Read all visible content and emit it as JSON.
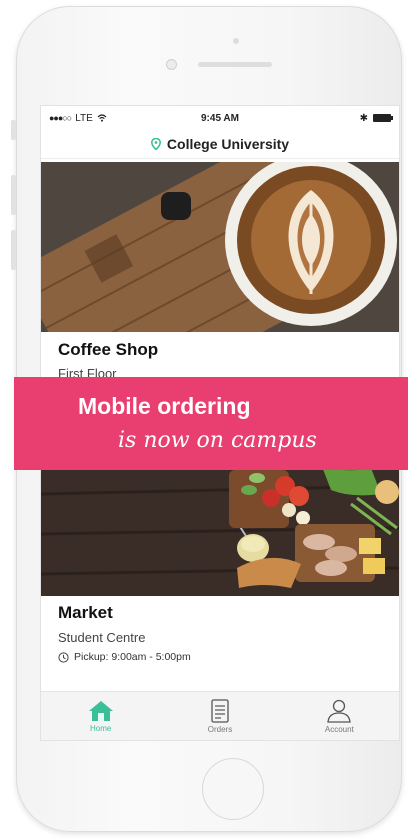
{
  "status_bar": {
    "carrier": "LTE",
    "time": "9:45 AM"
  },
  "location": {
    "name": "College University",
    "icon": "location-pin-icon"
  },
  "cards": [
    {
      "title": "Coffee Shop",
      "subtitle": "First Floor"
    },
    {
      "title": "Market",
      "subtitle": "Student Centre",
      "pickup": "Pickup: 9:00am - 5:00pm"
    }
  ],
  "banner": {
    "line1": "Mobile ordering",
    "line2": "is now on campus",
    "color": "#e83e70"
  },
  "tabs": [
    {
      "label": "Home",
      "icon": "home-icon",
      "active": true
    },
    {
      "label": "Orders",
      "icon": "receipt-icon",
      "active": false
    },
    {
      "label": "Account",
      "icon": "person-icon",
      "active": false
    }
  ],
  "colors": {
    "accent": "#3bbf99",
    "banner": "#e83e70"
  }
}
